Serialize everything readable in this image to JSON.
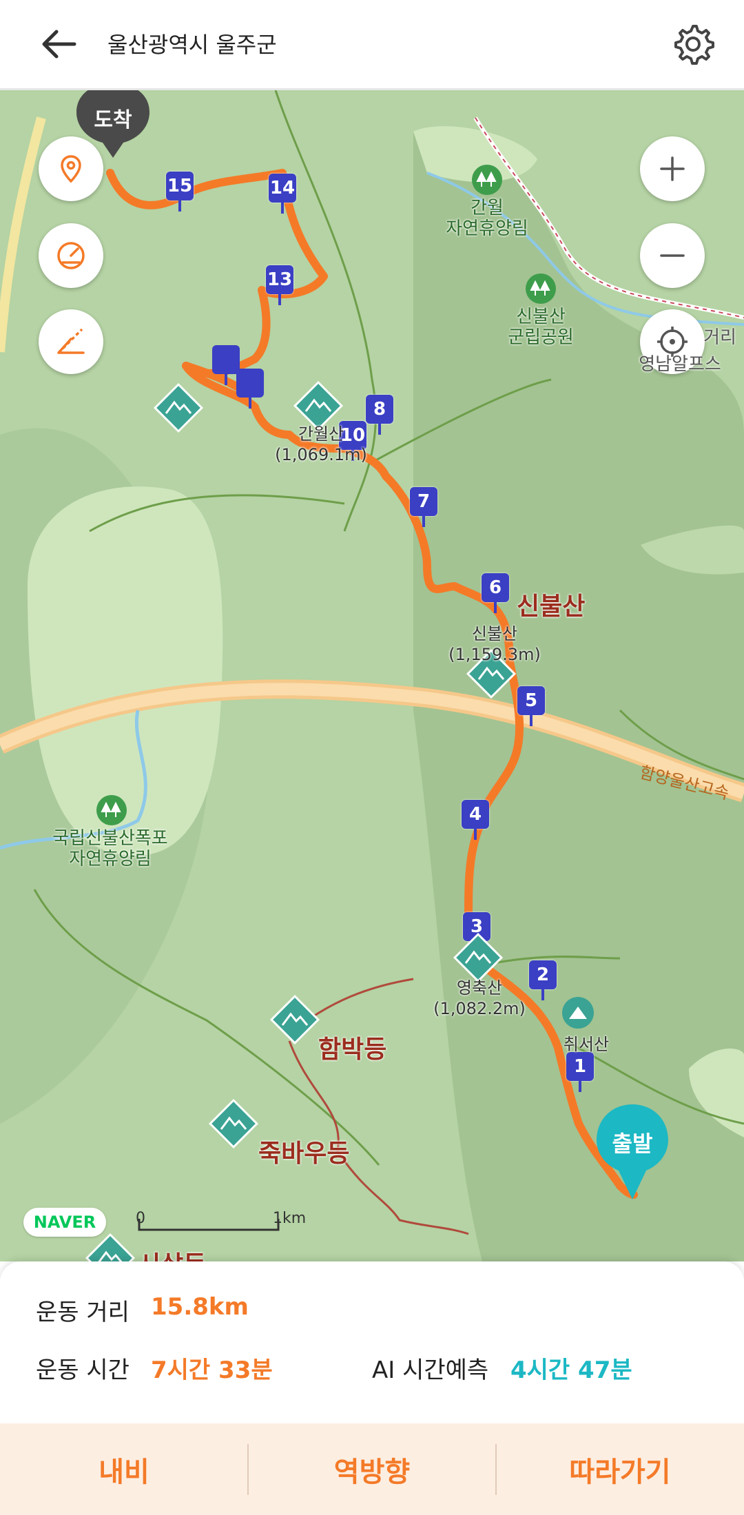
{
  "header": {
    "title": "울산광역시 울주군"
  },
  "map": {
    "arrival_label": "도착",
    "start_label": "출발",
    "places": {
      "ganwol_forest": "간월\n자연휴양림",
      "sinbul_park": "신불산\n군립공원",
      "sinbul_falls_forest": "국립신불산폭포\n자연휴양림",
      "yeongnam": "영남알프스",
      "right_edge": "거리"
    },
    "peaks": {
      "ganwolsan": "간월산\n(1,069.1m)",
      "sinbulsan_name": "신불산",
      "sinbulsan_sub": "신불산\n(1,159.3m)",
      "yeongchuksan": "영축산\n(1,082.2m)",
      "hambakdeung": "함박등",
      "jukbaudeung": "죽바우등",
      "sisal": "시살등",
      "chwiseosan": "취서산"
    },
    "road": "함양울산고속",
    "waypoints": [
      "1",
      "2",
      "3",
      "4",
      "5",
      "6",
      "7",
      "8",
      "10",
      "13",
      "14",
      "15"
    ],
    "scale": {
      "zero": "0",
      "one": "1km"
    },
    "logo": "NAVER"
  },
  "info": {
    "distance_label": "운동 거리",
    "distance_value": "15.8km",
    "time_label": "운동 시간",
    "time_value": "7시간 33분",
    "ai_label": "AI 시간예측",
    "ai_value": "4시간 47분"
  },
  "actions": {
    "navi": "내비",
    "reverse": "역방향",
    "follow": "따라가기"
  },
  "colors": {
    "accent": "#f47a28",
    "teal": "#1cb8c4",
    "marker": "#3a3fc4"
  }
}
